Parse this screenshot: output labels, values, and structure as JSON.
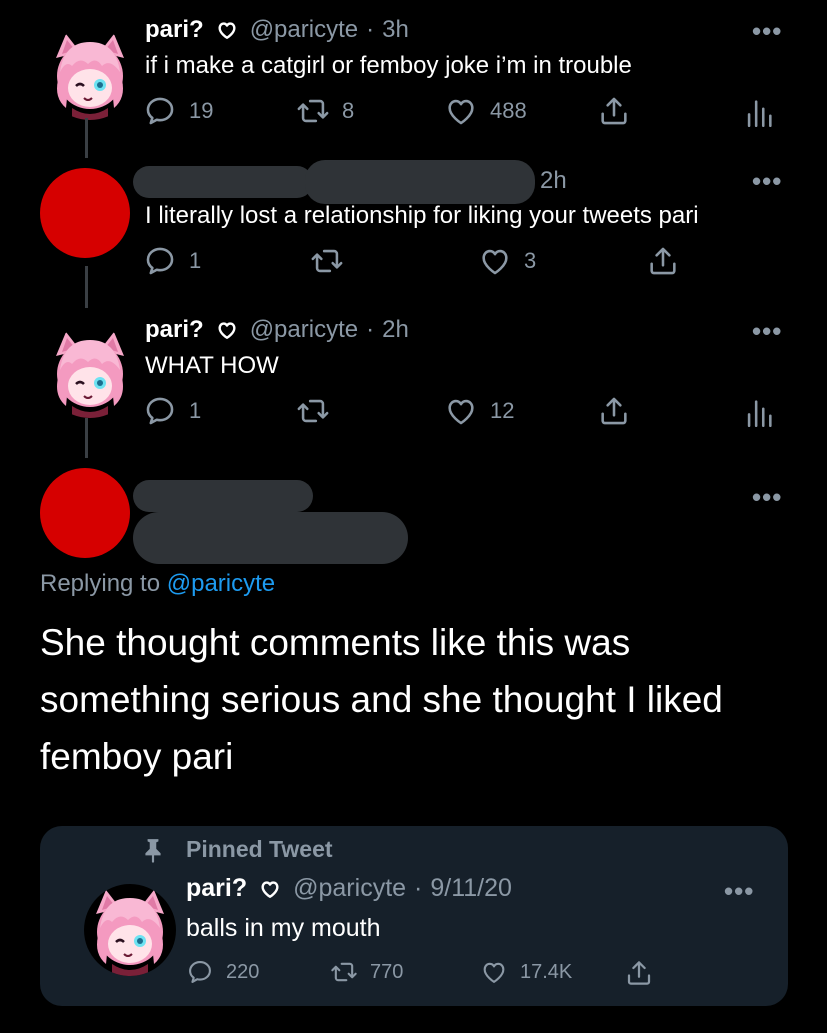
{
  "tweets": [
    {
      "display_name": "pari?",
      "handle": "@paricyte",
      "time": "3h",
      "text": "if i make a catgirl or femboy joke i’m in trouble",
      "replies": "19",
      "retweets": "8",
      "likes": "488"
    },
    {
      "time": "2h",
      "text": "I literally lost a relationship for liking your tweets pari",
      "replies": "1",
      "retweets": "",
      "likes": "3"
    },
    {
      "display_name": "pari?",
      "handle": "@paricyte",
      "time": "2h",
      "text": "WHAT HOW",
      "replies": "1",
      "retweets": "",
      "likes": "12"
    }
  ],
  "focused": {
    "replying_prefix": "Replying to",
    "replying_handle": "@paricyte",
    "text": "She thought comments like this was something serious and she thought I liked femboy pari"
  },
  "pinned": {
    "label": "Pinned Tweet",
    "display_name": "pari?",
    "handle": "@paricyte",
    "date": "9/11/20",
    "text": "balls in my mouth",
    "replies": "220",
    "retweets": "770",
    "likes": "17.4K"
  },
  "ui": {
    "separator": "·",
    "more_glyph": "•••"
  },
  "colors": {
    "background": "#000000",
    "secondary_text": "#8b98a5",
    "link": "#1d9bf0",
    "card": "#16202a",
    "redaction": "#2f3337",
    "avatar_red": "#d60000"
  }
}
